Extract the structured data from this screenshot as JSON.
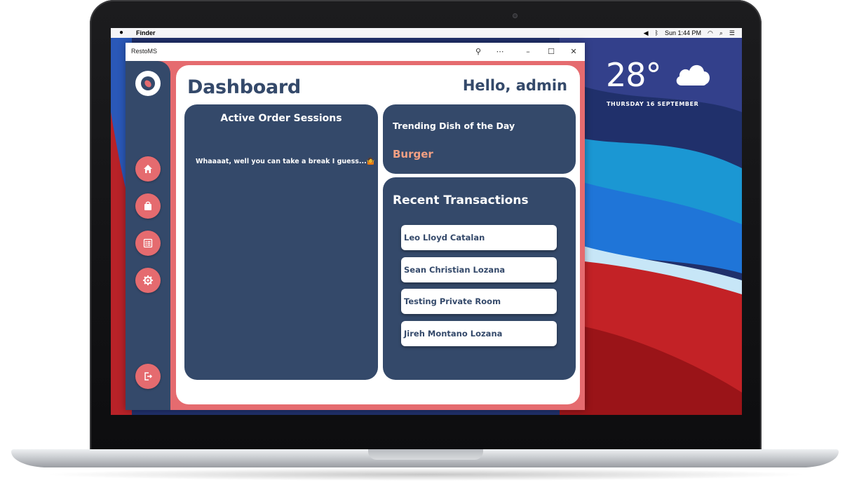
{
  "menubar": {
    "app_name": "Finder",
    "clock": "Sun 1:44 PM",
    "icons": [
      "apple-icon",
      "volume-icon",
      "bluetooth-icon",
      "wifi-icon",
      "search-icon",
      "control-center-icon"
    ]
  },
  "weather": {
    "temperature": "28°",
    "date": "THURSDAY 16 SEPTEMBER",
    "icon": "cloud-icon"
  },
  "window": {
    "title": "RestoMS",
    "controls": [
      "pin-icon",
      "more-icon",
      "minimize-icon",
      "maximize-icon",
      "close-icon"
    ]
  },
  "sidebar": {
    "logo": "app-logo",
    "items": [
      {
        "name": "home",
        "icon": "home-icon"
      },
      {
        "name": "orders",
        "icon": "bag-icon"
      },
      {
        "name": "menu",
        "icon": "list-icon"
      },
      {
        "name": "settings",
        "icon": "gear-icon"
      }
    ],
    "logout_icon": "logout-icon"
  },
  "dashboard": {
    "title": "Dashboard",
    "greeting": "Hello, admin",
    "active_orders": {
      "title": "Active Order Sessions",
      "empty_message": "Whaaaat, well you can take a break I guess...🤷"
    },
    "trending": {
      "title": "Trending Dish of the Day",
      "dish": "Burger"
    },
    "transactions": {
      "title": "Recent Transactions",
      "items": [
        "Leo Lloyd Catalan",
        "Sean Christian Lozana",
        "Testing Private Room",
        "Jireh Montano Lozana"
      ]
    }
  },
  "colors": {
    "primary": "#34496a",
    "accent": "#e56b6f",
    "highlight": "#f3a083",
    "surface": "#ffffff"
  }
}
